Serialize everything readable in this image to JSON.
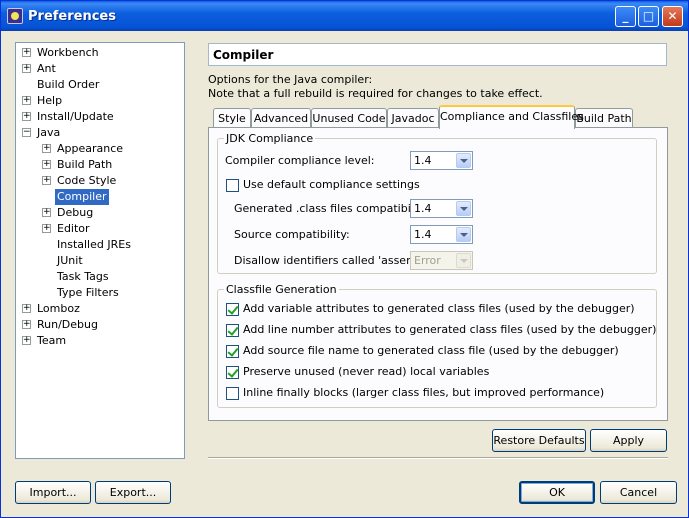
{
  "window": {
    "title": "Preferences"
  },
  "tree": [
    {
      "label": "Workbench",
      "level": 0,
      "expander": "+"
    },
    {
      "label": "Ant",
      "level": 0,
      "expander": "+"
    },
    {
      "label": "Build Order",
      "level": 0,
      "expander": ""
    },
    {
      "label": "Help",
      "level": 0,
      "expander": "+"
    },
    {
      "label": "Install/Update",
      "level": 0,
      "expander": "+"
    },
    {
      "label": "Java",
      "level": 0,
      "expander": "−"
    },
    {
      "label": "Appearance",
      "level": 1,
      "expander": "+"
    },
    {
      "label": "Build Path",
      "level": 1,
      "expander": "+"
    },
    {
      "label": "Code Style",
      "level": 1,
      "expander": "+"
    },
    {
      "label": "Compiler",
      "level": 1,
      "expander": "",
      "selected": true
    },
    {
      "label": "Debug",
      "level": 1,
      "expander": "+"
    },
    {
      "label": "Editor",
      "level": 1,
      "expander": "+"
    },
    {
      "label": "Installed JREs",
      "level": 1,
      "expander": ""
    },
    {
      "label": "JUnit",
      "level": 1,
      "expander": ""
    },
    {
      "label": "Task Tags",
      "level": 1,
      "expander": ""
    },
    {
      "label": "Type Filters",
      "level": 1,
      "expander": ""
    },
    {
      "label": "Lomboz",
      "level": 0,
      "expander": "+"
    },
    {
      "label": "Run/Debug",
      "level": 0,
      "expander": "+"
    },
    {
      "label": "Team",
      "level": 0,
      "expander": "+"
    }
  ],
  "page": {
    "title": "Compiler",
    "description_line1": "Options for the Java compiler:",
    "description_line2": "Note that a full rebuild is required for changes to take effect."
  },
  "tabs": [
    {
      "label": "Style",
      "active": false
    },
    {
      "label": "Advanced",
      "active": false
    },
    {
      "label": "Unused Code",
      "active": false
    },
    {
      "label": "Javadoc",
      "active": false
    },
    {
      "label": "Compliance and Classfiles",
      "active": true
    },
    {
      "label": "Build Path",
      "active": false
    }
  ],
  "jdk_compliance": {
    "legend": "JDK Compliance",
    "compliance_level_label": "Compiler compliance level:",
    "compliance_level_value": "1.4",
    "use_default_label": "Use default compliance settings",
    "use_default_checked": false,
    "generated_compat_label": "Generated .class files compatibility:",
    "generated_compat_value": "1.4",
    "source_compat_label": "Source compatibility:",
    "source_compat_value": "1.4",
    "disallow_assert_label": "Disallow identifiers called 'assert':",
    "disallow_assert_value": "Error"
  },
  "classfile_generation": {
    "legend": "Classfile Generation",
    "options": [
      {
        "label": "Add variable attributes to generated class files (used by the debugger)",
        "checked": true
      },
      {
        "label": "Add line number attributes to generated class files (used by the debugger)",
        "checked": true
      },
      {
        "label": "Add source file name to generated class file (used by the debugger)",
        "checked": true
      },
      {
        "label": "Preserve unused (never read) local variables",
        "checked": true
      },
      {
        "label": "Inline finally blocks (larger class files, but improved performance)",
        "checked": false
      }
    ]
  },
  "buttons": {
    "restore_defaults": "Restore Defaults",
    "apply": "Apply",
    "import": "Import...",
    "export": "Export...",
    "ok": "OK",
    "cancel": "Cancel"
  },
  "colors": {
    "titlebar": "#0a5fe5",
    "selection": "#316ac5",
    "active_tab_accent": "#ffc83c"
  }
}
